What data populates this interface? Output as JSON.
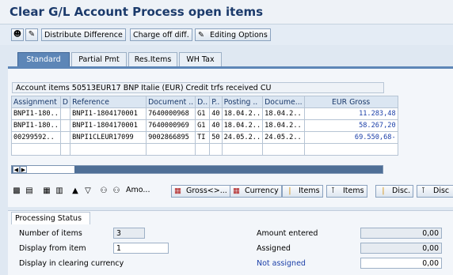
{
  "window": {
    "title": "Clear G/L Account Process open items"
  },
  "toolbar": {
    "distribute_label": "Distribute Difference",
    "chargeoff_label": "Charge off diff.",
    "editing_label": "Editing Options"
  },
  "tabs": [
    {
      "label": "Standard"
    },
    {
      "label": "Partial Pmt"
    },
    {
      "label": "Res.Items"
    },
    {
      "label": "WH Tax"
    }
  ],
  "table": {
    "caption": "Account items 50513EUR17 BNP Italie (EUR) Credit trfs received CU",
    "columns": [
      "Assignment",
      "D",
      "Reference",
      "Document ..",
      "D..",
      "P..",
      "Posting ..",
      "Docume...",
      "EUR Gross"
    ],
    "rows": [
      [
        "BNPI1-180..",
        "",
        "BNPI1-1804170001",
        "7640000968",
        "G1",
        "40",
        "18.04.2..",
        "18.04.2..",
        "11.283,48"
      ],
      [
        "BNPI1-180..",
        "",
        "BNPI1-1804170001",
        "7640000969",
        "G1",
        "40",
        "18.04.2..",
        "18.04.2..",
        "58.267,20"
      ],
      [
        "00299592..",
        "",
        "BNPI1CLEUR17099",
        "9002866895",
        "TI",
        "50",
        "24.05.2..",
        "24.05.2..",
        "69.550,68-"
      ]
    ]
  },
  "grid_toolbar": {
    "amount_label": "Amo...",
    "gross_label": "Gross<>...",
    "currency_label": "Currency",
    "items1_label": "Items",
    "items2_label": "Items",
    "disc1_label": "Disc.",
    "disc2_label": "Disc"
  },
  "status": {
    "caption": "Processing Status",
    "num_items_label": "Number of items",
    "num_items_value": "3",
    "display_from_label": "Display from item",
    "display_from_value": "1",
    "display_currency_label": "Display in clearing currency",
    "amount_entered_label": "Amount entered",
    "amount_entered_value": "0,00",
    "assigned_label": "Assigned",
    "assigned_value": "0,00",
    "not_assigned_label": "Not assigned",
    "not_assigned_value": "0,00"
  },
  "colors": {
    "accent": "#5d86b7",
    "title": "#1b3a6b",
    "amount": "#1b3fa8"
  }
}
